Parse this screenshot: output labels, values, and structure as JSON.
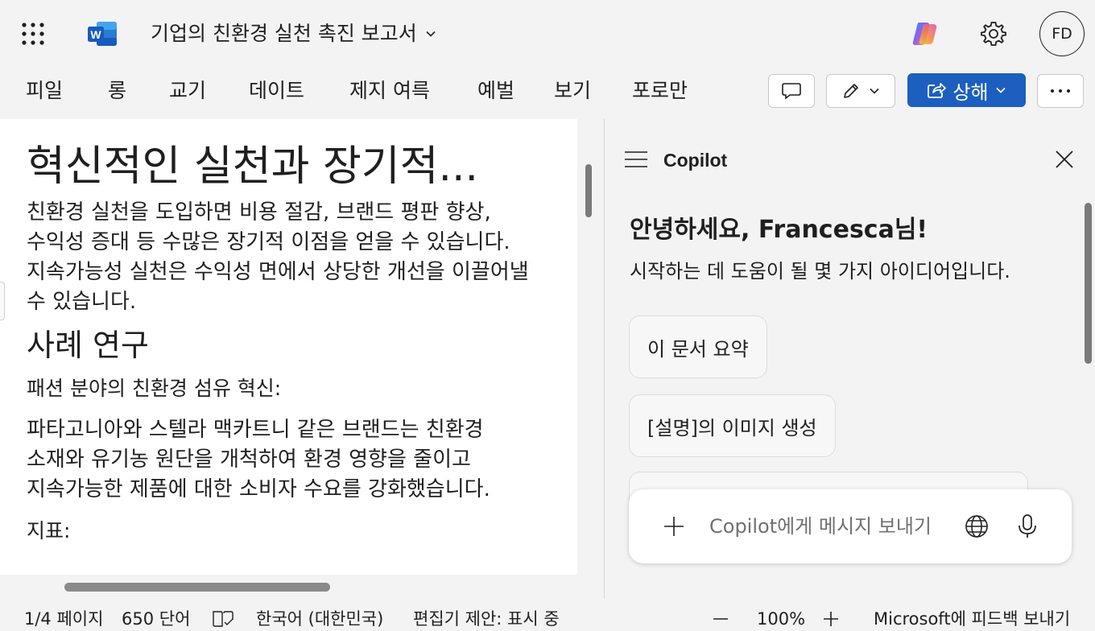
{
  "header": {
    "app_icon": "word-icon",
    "word_logo_letter": "W",
    "doc_title": "기업의 친환경 실천 촉진 보고서",
    "avatar_initials": "FD",
    "brand_colors": {
      "word": "#185abd",
      "share": "#1c5fbf"
    }
  },
  "ribbon": {
    "menu": [
      "피일",
      "롱",
      "교기",
      "데이트",
      "제지 여륵",
      "예벌",
      "보기",
      "포로만"
    ],
    "share_label": "상해"
  },
  "document": {
    "heading": "혁신적인 실천과 장기적...",
    "paragraph_lines": [
      "친환경 실천을 도입하면 비용 절감, 브랜드 평판 향상,",
      "수익성 증대 등 수많은 장기적 이점을 얻을 수 있습니다.",
      "지속가능성 실천은 수익성 면에서 상당한 개선을 이끌어낼",
      "수 있습니다."
    ],
    "section_title": "사례 연구",
    "case_title": "패션 분야의 친환경 섬유 혁신:",
    "case_lines": [
      "파타고니아와 스텔라 맥카트니 같은 브랜드는 친환경",
      "소재와 유기농 원단을 개척하여 환경 영향을 줄이고",
      "지속가능한 제품에 대한 소비자 수요를 강화했습니다."
    ],
    "metrics_label": "지표:"
  },
  "copilot": {
    "title": "Copilot",
    "greeting": "안녕하세요, Francesca님!",
    "subtitle": "시작하는 데 도움이 될 몇 가지 아이디어입니다.",
    "suggestions": [
      "이 문서 요약",
      "[설명]의 이미지 생성"
    ],
    "input_placeholder": "Copilot에게 메시지 보내기"
  },
  "status": {
    "page": "1/4 페이지",
    "words": "650 단어",
    "language": "한국어 (대한민국)",
    "editor": "편집기 제안: 표시 중",
    "zoom": "100%",
    "feedback": "Microsoft에 피드백 보내기"
  }
}
